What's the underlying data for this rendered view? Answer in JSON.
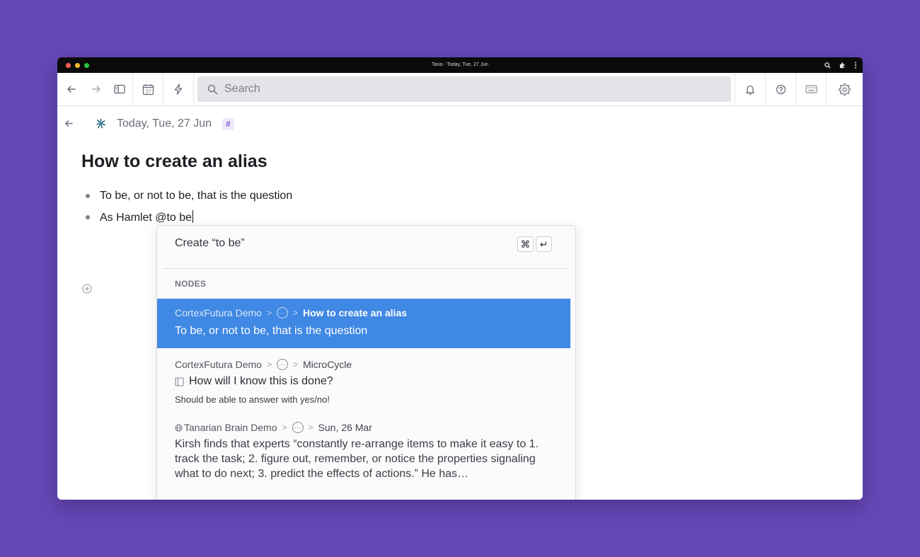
{
  "window": {
    "title": "Tana - Today, Tue, 27 Jun"
  },
  "toolbar": {
    "calendar_day": "27",
    "search_placeholder": "Search"
  },
  "page": {
    "breadcrumb": "Today, Tue, 27 Jun",
    "tag_symbol": "#",
    "title": "How to create an alias",
    "bullets": [
      "To be, or not to be, that is the question",
      "As Hamlet @to be"
    ]
  },
  "popup": {
    "create_label": "Create “to be”",
    "shortcut_keys": [
      "⌘",
      "↵"
    ],
    "section_label": "NODES",
    "results": [
      {
        "path": [
          "CortexFutura Demo",
          "···",
          "How to create an alias"
        ],
        "title": "To be, or not to be, that is the question",
        "selected": true
      },
      {
        "path": [
          "CortexFutura Demo",
          "···",
          "MicroCycle"
        ],
        "title": "How will I know this is done?",
        "subtitle": "Should be able to answer with yes/no!",
        "selected": false
      },
      {
        "path": [
          "Tanarian Brain Demo",
          "···",
          "Sun, 26 Mar"
        ],
        "body": "Kirsh finds that experts “constantly re-arrange items to make it easy to 1. track the task; 2. figure out, remember, or notice the properties signaling what to do next; 3. predict the effects of actions.” He has…",
        "selected": false
      }
    ]
  },
  "colors": {
    "background": "#6647b8",
    "selection": "#3f88e3",
    "tag": "#7c55d4"
  }
}
